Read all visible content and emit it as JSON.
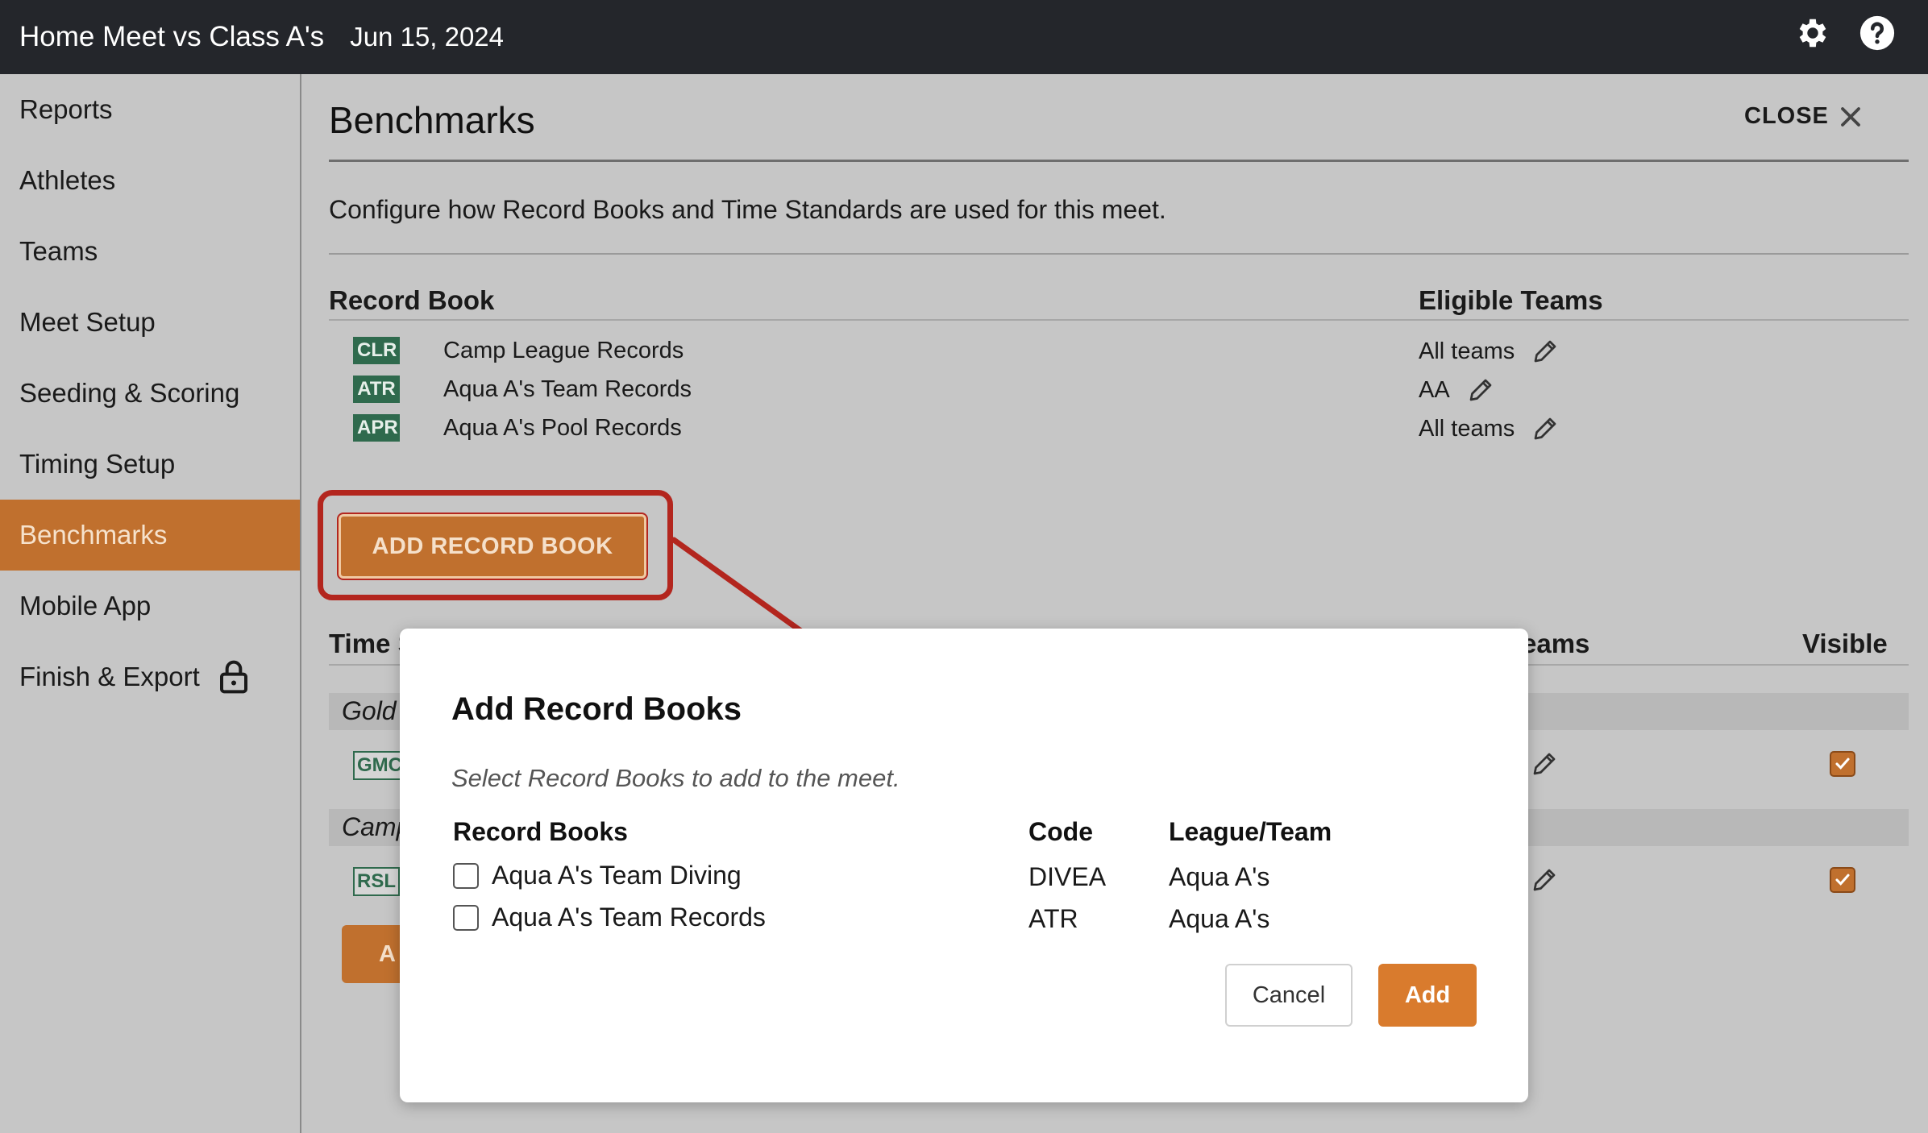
{
  "header": {
    "title": "Home Meet vs Class A's",
    "date": "Jun 15, 2024",
    "settings_icon": "gear-icon",
    "help_icon": "help-icon"
  },
  "sidebar": {
    "items": [
      {
        "label": "Reports"
      },
      {
        "label": "Athletes"
      },
      {
        "label": "Teams"
      },
      {
        "label": "Meet Setup"
      },
      {
        "label": "Seeding & Scoring"
      },
      {
        "label": "Timing Setup"
      },
      {
        "label": "Benchmarks",
        "active": true
      },
      {
        "label": "Mobile App"
      },
      {
        "label": "Finish & Export",
        "icon": "lock-icon"
      }
    ]
  },
  "main": {
    "title": "Benchmarks",
    "close_label": "CLOSE",
    "description": "Configure how Record Books and Time Standards are used for this meet.",
    "record_book_header": "Record Book",
    "eligible_teams_header": "Eligible Teams",
    "record_books": [
      {
        "code": "CLR",
        "name": "Camp League Records",
        "teams": "All teams"
      },
      {
        "code": "ATR",
        "name": "Aqua A's Team Records",
        "teams": "AA"
      },
      {
        "code": "APR",
        "name": "Aqua A's Pool Records",
        "teams": "All teams"
      }
    ],
    "add_record_book_label": "ADD RECORD BOOK",
    "time_standards_header_partial": "Time S",
    "teams_header_partial": "eams",
    "visible_header": "Visible",
    "groups": [
      {
        "label_partial": "Gold",
        "code_partial": "GMC",
        "visible": true
      },
      {
        "label_partial": "Camp",
        "code_partial": "RSL",
        "visible": true
      }
    ],
    "add_button_partial": "A"
  },
  "modal": {
    "title": "Add Record Books",
    "subtitle": "Select Record Books to add to the meet.",
    "columns": [
      "Record Books",
      "Code",
      "League/Team"
    ],
    "rows": [
      {
        "name": "Aqua A's Team Diving",
        "code": "DIVEA",
        "team": "Aqua A's",
        "checked": false
      },
      {
        "name": "Aqua A's Team Records",
        "code": "ATR",
        "team": "Aqua A's",
        "checked": false
      }
    ],
    "cancel_label": "Cancel",
    "add_label": "Add"
  },
  "colors": {
    "topbar": "#24262b",
    "accent": "#c0702e",
    "badge_green": "#2f6a4d",
    "highlight_red": "#b3261e",
    "overlay_bg": "#c6c6c6"
  }
}
